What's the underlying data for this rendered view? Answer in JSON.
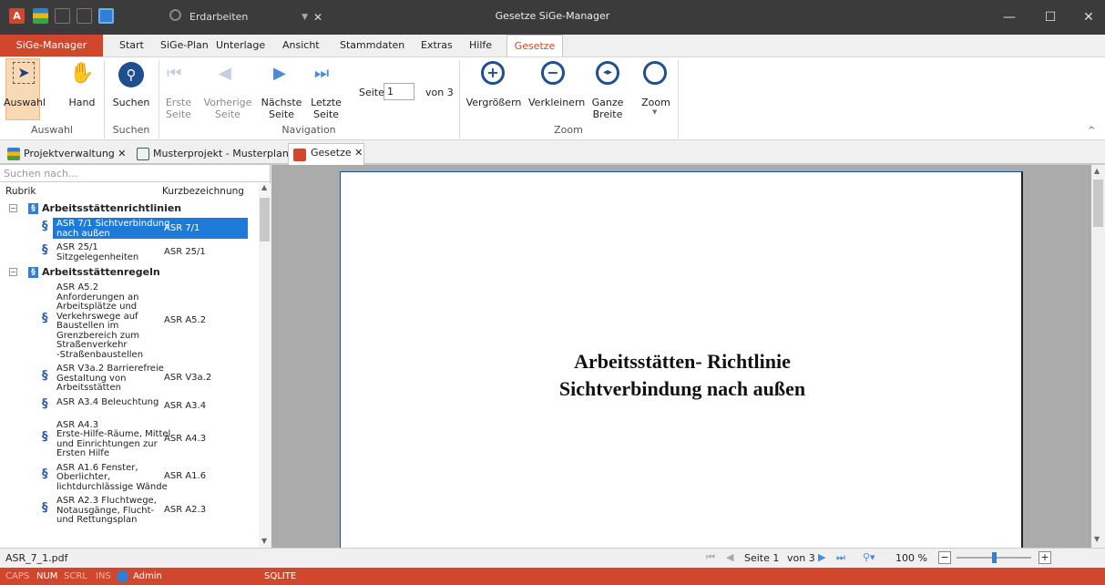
{
  "window": {
    "title": "Gesetze SiGe-Manager",
    "quick_combo": "Erdarbeiten",
    "minimize": "—",
    "maximize": "☐",
    "close": "✕"
  },
  "tabs": {
    "app": "SiGe-Manager",
    "items": [
      "Start",
      "SiGe-Plan",
      "Unterlage",
      "Ansicht",
      "Stammdaten",
      "Extras",
      "Hilfe"
    ],
    "active": "Gesetze"
  },
  "ribbon": {
    "auswahl": "Auswahl",
    "hand": "Hand",
    "group_auswahl": "Auswahl",
    "suchen": "Suchen",
    "group_suchen": "Suchen",
    "erste": [
      "Erste",
      "Seite"
    ],
    "vorherige": [
      "Vorherige",
      "Seite"
    ],
    "naechste": [
      "Nächste",
      "Seite"
    ],
    "letzte": [
      "Letzte",
      "Seite"
    ],
    "seite_label": "Seite",
    "seite_value": "1",
    "von": "von 3",
    "group_navigation": "Navigation",
    "vergroessern": "Vergrößern",
    "verkleinern": "Verkleinern",
    "ganze": [
      "Ganze",
      "Breite"
    ],
    "zoom": "Zoom",
    "group_zoom": "Zoom"
  },
  "doctabs": [
    "Projektverwaltung",
    "Musterprojekt - Musterplan",
    "Gesetze"
  ],
  "left": {
    "search_placeholder": "Suchen nach...",
    "col_rubrik": "Rubrik",
    "col_kurz": "Kurzbezeichnung",
    "groups": [
      {
        "label": "Arbeitsstättenrichtlinien",
        "items": [
          {
            "lines": [
              "ASR 7/1 Sichtverbindung",
              "nach außen"
            ],
            "kurz": "ASR 7/1",
            "selected": true
          },
          {
            "lines": [
              "ASR 25/1",
              "Sitzgelegenheiten"
            ],
            "kurz": "ASR 25/1"
          }
        ]
      },
      {
        "label": "Arbeitsstättenregeln",
        "items": [
          {
            "lines": [
              "ASR A5.2",
              "Anforderungen an",
              "Arbeitsplätze und",
              "Verkehrswege auf",
              "Baustellen im",
              "Grenzbereich zum",
              "Straßenverkehr",
              "-Straßenbaustellen"
            ],
            "kurz": "ASR A5.2"
          },
          {
            "lines": [
              "ASR V3a.2 Barrierefreie",
              "Gestaltung von",
              "Arbeitsstätten"
            ],
            "kurz": "ASR V3a.2"
          },
          {
            "lines": [
              "ASR A3.4 Beleuchtung"
            ],
            "kurz": "ASR A3.4"
          },
          {
            "lines": [
              "ASR A4.3",
              "Erste-Hilfe-Räume, Mittel",
              "und Einrichtungen zur",
              "Ersten Hilfe"
            ],
            "kurz": "ASR A4.3"
          },
          {
            "lines": [
              "ASR A1.6 Fenster,",
              "Oberlichter,",
              "lichtdurchlässige Wände"
            ],
            "kurz": "ASR A1.6"
          },
          {
            "lines": [
              "ASR A2.3 Fluchtwege,",
              "Notausgänge, Flucht-",
              "und Rettungsplan"
            ],
            "kurz": "ASR A2.3"
          }
        ]
      }
    ]
  },
  "document": {
    "line1": "Arbeitsstätten- Richtlinie",
    "line2": "Sichtverbindung nach außen"
  },
  "status": {
    "file": "ASR_7_1.pdf",
    "seite": "Seite 1",
    "von": "von 3",
    "zoom": "100 %",
    "zoom_level": 0.5,
    "minus": "−",
    "plus": "+"
  },
  "bottom": {
    "caps": "CAPS",
    "num": "NUM",
    "scrl": "SCRL",
    "ins": "INS",
    "user": "Admin",
    "db": "SQLITE"
  }
}
